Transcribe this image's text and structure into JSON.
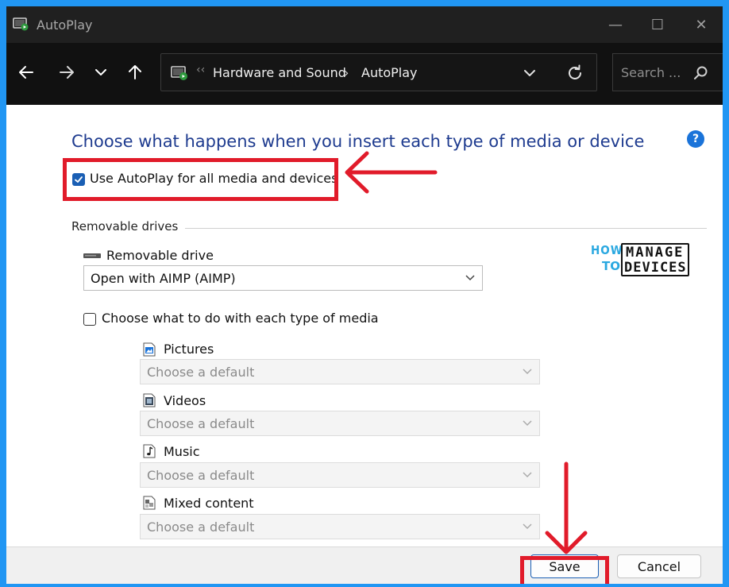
{
  "window": {
    "title": "AutoPlay",
    "controls": {
      "minimize": "—",
      "maximize": "☐",
      "close": "✕"
    }
  },
  "nav": {
    "back": "back-icon",
    "forward": "forward-icon",
    "recent": "chevron-down-icon",
    "up": "up-icon"
  },
  "address": {
    "overflow": "‹‹",
    "crumbs": [
      "Hardware and Sound",
      "AutoPlay"
    ],
    "separator": "›"
  },
  "search": {
    "placeholder": "Search ..."
  },
  "main": {
    "heading": "Choose what happens when you insert each type of media or device",
    "help_label": "?",
    "use_autoplay": {
      "label": "Use AutoPlay for all media and devices",
      "checked": true
    },
    "removable_group": "Removable drives",
    "removable_drive": {
      "label": "Removable drive",
      "selected": "Open with AIMP (AIMP)"
    },
    "per_media": {
      "label": "Choose what to do with each type of media",
      "checked": false
    },
    "media": [
      {
        "label": "Pictures",
        "icon": "pictures-icon",
        "selected": "Choose a default"
      },
      {
        "label": "Videos",
        "icon": "videos-icon",
        "selected": "Choose a default"
      },
      {
        "label": "Music",
        "icon": "music-icon",
        "selected": "Choose a default"
      },
      {
        "label": "Mixed content",
        "icon": "mixed-content-icon",
        "selected": "Choose a default"
      }
    ]
  },
  "logo": {
    "how": "HOW",
    "to": "TO",
    "manage": "MANAGE",
    "devices": "DEVICES"
  },
  "footer": {
    "save": "Save",
    "cancel": "Cancel"
  },
  "colors": {
    "accent": "#1a5fb4",
    "heading": "#1e3b8f",
    "annotation": "#e11b2a",
    "border_frame": "#2196f3"
  }
}
